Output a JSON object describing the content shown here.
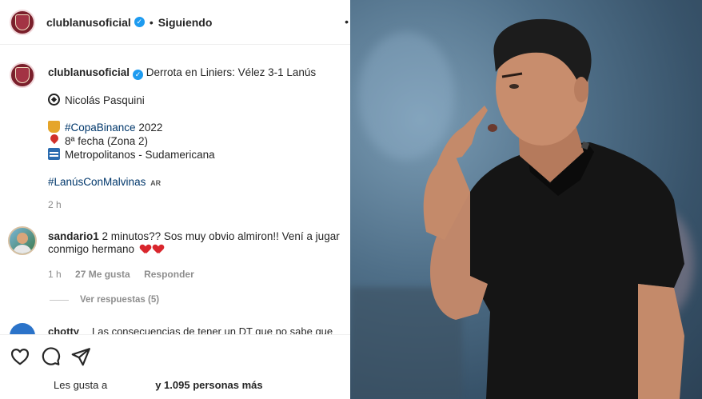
{
  "post": {
    "header": {
      "username": "clublanusoficial",
      "separator": "•",
      "follow_status": "Siguiendo"
    },
    "caption": {
      "username": "clublanusoficial",
      "title": "Derrota en Liniers: Vélez 3-1 Lanús",
      "scorer": "Nicolás Pasquini",
      "competition_tag": "#CopaBinance",
      "competition_year": " 2022",
      "round": "8ª fecha (Zona 2)",
      "venue": "Metropolitanos - Sudamericana",
      "hashtag": "#LanúsConMalvinas",
      "flag": "AR"
    },
    "timestamp": "2 h",
    "comment": {
      "username": "sandario1",
      "text": "2 minutos?? Sos muy obvio almiron!! Vení a jugar conmigo hermano",
      "time": "1 h",
      "likes": "27 Me gusta",
      "reply_label": "Responder",
      "view_replies": "Ver respuestas (5)"
    },
    "next_comment": {
      "username": "chotty",
      "text": "Las consecuencias de tener un DT que no sabe que"
    },
    "likes": {
      "prefix": "Les gusta a",
      "suffix": "y 1.095 personas más"
    }
  },
  "colors": {
    "club_primary": "#7a1f2b",
    "verified": "#1d9bf0",
    "link": "#00376b",
    "meta": "#8e8e8e"
  },
  "icons": [
    "heart-icon",
    "comment-icon",
    "share-icon",
    "verified-icon",
    "more-icon"
  ]
}
